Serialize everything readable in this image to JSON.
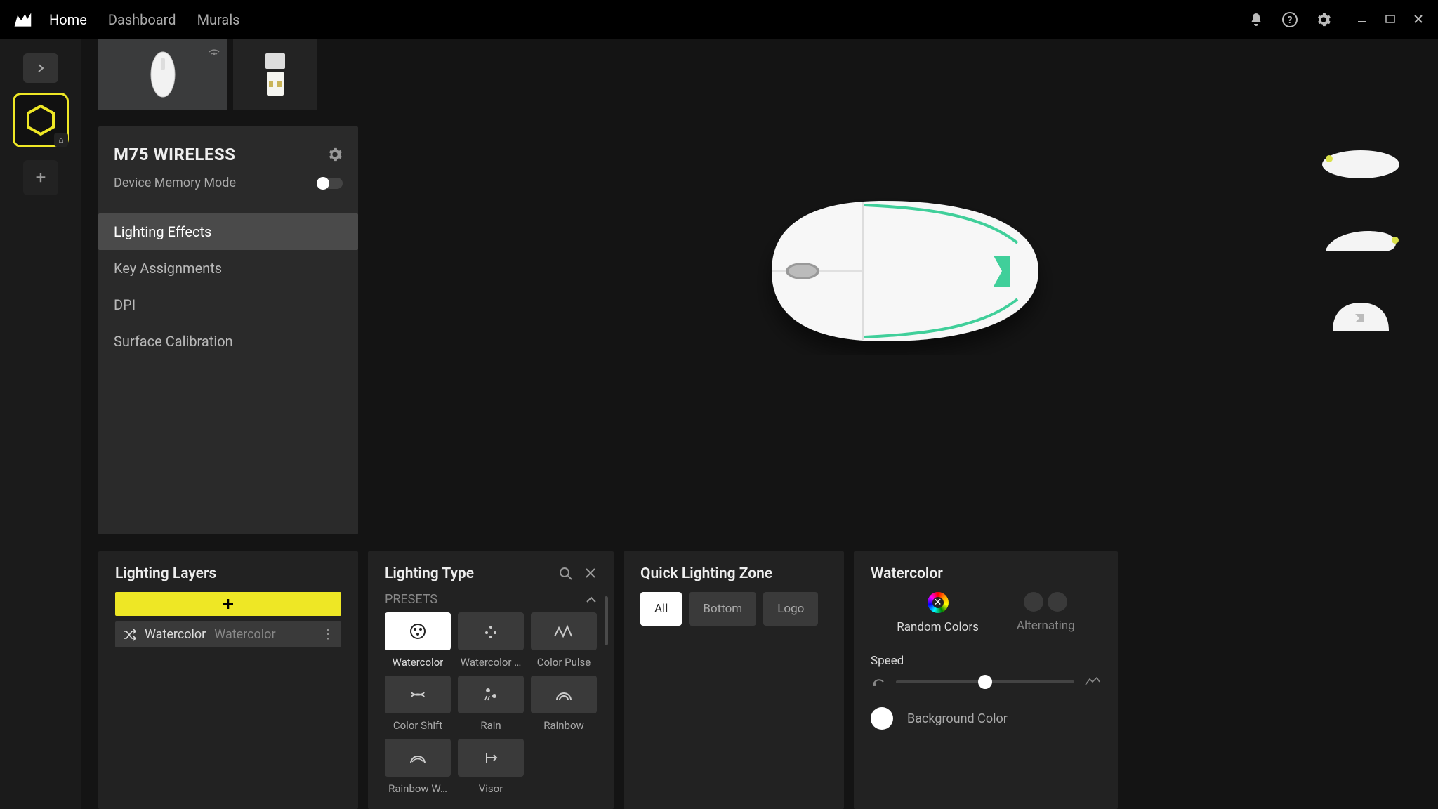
{
  "titlebar": {
    "nav": [
      "Home",
      "Dashboard",
      "Murals"
    ]
  },
  "device": {
    "name": "M75 WIRELESS",
    "memory_label": "Device Memory Mode",
    "menu": [
      "Lighting Effects",
      "Key Assignments",
      "DPI",
      "Surface Calibration"
    ],
    "active_menu": 0
  },
  "layers": {
    "title": "Lighting Layers",
    "items": [
      {
        "name": "Watercolor",
        "effect": "Watercolor"
      }
    ]
  },
  "type": {
    "title": "Lighting Type",
    "section": "PRESETS",
    "presets": [
      "Watercolor",
      "Watercolor …",
      "Color Pulse",
      "Color Shift",
      "Rain",
      "Rainbow",
      "Rainbow W…",
      "Visor"
    ],
    "active": 0
  },
  "zone": {
    "title": "Quick Lighting Zone",
    "buttons": [
      "All",
      "Bottom",
      "Logo"
    ],
    "active": 0
  },
  "effect": {
    "title": "Watercolor",
    "opts": [
      "Random Colors",
      "Alternating"
    ],
    "speed_label": "Speed",
    "bg_label": "Background Color"
  }
}
